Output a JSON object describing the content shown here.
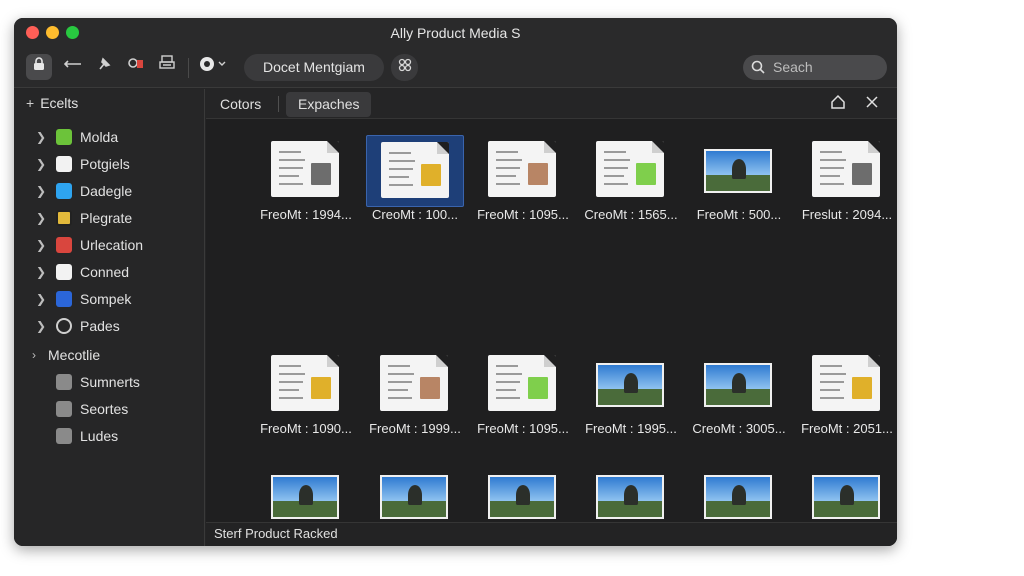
{
  "window": {
    "title": "Ally Product Media S"
  },
  "toolbar": {
    "path_label": "Docet Mentgiam",
    "search_placeholder": "Seach"
  },
  "sidebar": {
    "header": "Ecelts",
    "items": [
      {
        "label": "Molda",
        "icon_color": "#6cc33a"
      },
      {
        "label": "Potgiels",
        "icon_color": "#f2f2f2"
      },
      {
        "label": "Dadegle",
        "icon_color": "#2ea4f0"
      },
      {
        "label": "Plegrate",
        "icon_color": "#e2b93b"
      },
      {
        "label": "Urlecation",
        "icon_color": "#d9463e"
      },
      {
        "label": "Conned",
        "icon_color": "#f2f2f2"
      },
      {
        "label": "Sompek",
        "icon_color": "#2b66d9"
      },
      {
        "label": "Pades",
        "icon_color": "#cfcfcf"
      }
    ],
    "group_header": "Mecotlie",
    "group_items": [
      {
        "label": "Sumnerts"
      },
      {
        "label": "Seortes"
      },
      {
        "label": "Ludes"
      }
    ]
  },
  "tabs": [
    {
      "label": "Cotors"
    },
    {
      "label": "Expaches"
    }
  ],
  "files": [
    {
      "name": "FreoMt : 1994...",
      "kind": "doc"
    },
    {
      "name": "CreoMt : 100...",
      "kind": "doc"
    },
    {
      "name": "FreoMt : 1095...",
      "kind": "doc"
    },
    {
      "name": "CreoMt : 1565...",
      "kind": "doc"
    },
    {
      "name": "FreoMt : 500...",
      "kind": "photo"
    },
    {
      "name": "Freslut : 2094...",
      "kind": "doc"
    },
    {
      "name": "FreoMt : 1090...",
      "kind": "doc"
    },
    {
      "name": "FreoMt : 1999...",
      "kind": "doc"
    },
    {
      "name": "FreoMt : 1095...",
      "kind": "doc"
    },
    {
      "name": "FreoMt : 1995...",
      "kind": "photo"
    },
    {
      "name": "CreoMt : 3005...",
      "kind": "photo"
    },
    {
      "name": "FreoMt : 2051...",
      "kind": "doc"
    },
    {
      "name": "",
      "kind": "photo"
    },
    {
      "name": "",
      "kind": "photo"
    },
    {
      "name": "",
      "kind": "photo"
    },
    {
      "name": "",
      "kind": "photo"
    },
    {
      "name": "",
      "kind": "photo"
    },
    {
      "name": "",
      "kind": "photo"
    }
  ],
  "status": {
    "text": "Sterf Product Racked"
  }
}
